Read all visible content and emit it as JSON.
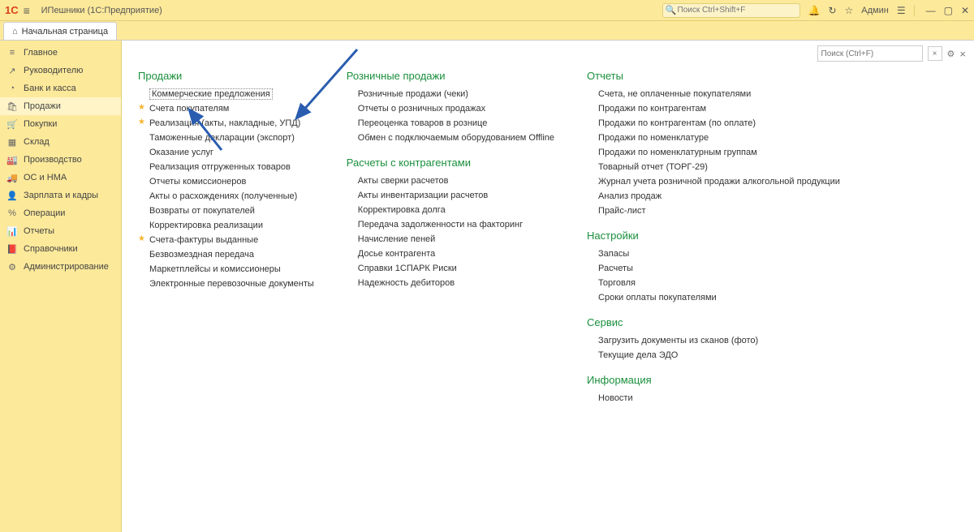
{
  "titlebar": {
    "app_title": "ИПешники  (1С:Предприятие)",
    "search_placeholder": "Поиск Ctrl+Shift+F",
    "user": "Админ"
  },
  "tabs": [
    {
      "label": "Начальная страница"
    }
  ],
  "sidebar": [
    {
      "icon": "≡",
      "label": "Главное",
      "name": "sidebar-main"
    },
    {
      "icon": "↗",
      "label": "Руководителю",
      "name": "sidebar-manager"
    },
    {
      "icon": "◔",
      "label": "Банк и касса",
      "name": "sidebar-bank"
    },
    {
      "icon": "🛍",
      "label": "Продажи",
      "name": "sidebar-sales",
      "active": true
    },
    {
      "icon": "🛒",
      "label": "Покупки",
      "name": "sidebar-purchases"
    },
    {
      "icon": "▦",
      "label": "Склад",
      "name": "sidebar-warehouse"
    },
    {
      "icon": "🏭",
      "label": "Производство",
      "name": "sidebar-production"
    },
    {
      "icon": "🚚",
      "label": "ОС и НМА",
      "name": "sidebar-assets"
    },
    {
      "icon": "👤",
      "label": "Зарплата и кадры",
      "name": "sidebar-payroll"
    },
    {
      "icon": "%",
      "label": "Операции",
      "name": "sidebar-operations"
    },
    {
      "icon": "📊",
      "label": "Отчеты",
      "name": "sidebar-reports"
    },
    {
      "icon": "📕",
      "label": "Справочники",
      "name": "sidebar-catalogs"
    },
    {
      "icon": "⚙",
      "label": "Администрирование",
      "name": "sidebar-admin"
    }
  ],
  "content_search_placeholder": "Поиск (Ctrl+F)",
  "columns": [
    {
      "sections": [
        {
          "title": "Продажи",
          "links": [
            {
              "label": "Коммерческие предложения",
              "boxed": true
            },
            {
              "label": "Счета покупателям",
              "starred": true
            },
            {
              "label": "Реализация (акты, накладные, УПД)",
              "starred": true
            },
            {
              "label": "Таможенные декларации (экспорт)"
            },
            {
              "label": "Оказание услуг"
            },
            {
              "label": "Реализация отгруженных товаров"
            },
            {
              "label": "Отчеты комиссионеров"
            },
            {
              "label": "Акты о расхождениях (полученные)"
            },
            {
              "label": "Возвраты от покупателей"
            },
            {
              "label": "Корректировка реализации"
            },
            {
              "label": "Счета-фактуры выданные",
              "starred": true
            },
            {
              "label": "Безвозмездная передача"
            },
            {
              "label": "Маркетплейсы и комиссионеры"
            },
            {
              "label": "Электронные перевозочные документы"
            }
          ]
        }
      ]
    },
    {
      "sections": [
        {
          "title": "Розничные продажи",
          "links": [
            {
              "label": "Розничные продажи (чеки)"
            },
            {
              "label": "Отчеты о розничных продажах"
            },
            {
              "label": "Переоценка товаров в рознице"
            },
            {
              "label": "Обмен с подключаемым оборудованием Offline"
            }
          ]
        },
        {
          "title": "Расчеты с контрагентами",
          "links": [
            {
              "label": "Акты сверки расчетов"
            },
            {
              "label": "Акты инвентаризации расчетов"
            },
            {
              "label": "Корректировка долга"
            },
            {
              "label": "Передача задолженности на факторинг"
            },
            {
              "label": "Начисление пеней"
            },
            {
              "label": "Досье контрагента"
            },
            {
              "label": "Справки 1СПАРК Риски"
            },
            {
              "label": "Надежность дебиторов"
            }
          ]
        }
      ]
    },
    {
      "sections": [
        {
          "title": "Отчеты",
          "links": [
            {
              "label": "Счета, не оплаченные покупателями"
            },
            {
              "label": "Продажи по контрагентам"
            },
            {
              "label": "Продажи по контрагентам (по оплате)"
            },
            {
              "label": "Продажи по номенклатуре"
            },
            {
              "label": "Продажи по номенклатурным группам"
            },
            {
              "label": "Товарный отчет (ТОРГ-29)"
            },
            {
              "label": "Журнал учета розничной продажи алкогольной продукции"
            },
            {
              "label": "Анализ продаж"
            },
            {
              "label": "Прайс-лист"
            }
          ]
        },
        {
          "title": "Настройки",
          "links": [
            {
              "label": "Запасы"
            },
            {
              "label": "Расчеты"
            },
            {
              "label": "Торговля"
            },
            {
              "label": "Сроки оплаты покупателями"
            }
          ]
        },
        {
          "title": "Сервис",
          "links": [
            {
              "label": "Загрузить документы из сканов (фото)"
            },
            {
              "label": "Текущие дела ЭДО"
            }
          ]
        },
        {
          "title": "Информация",
          "links": [
            {
              "label": "Новости"
            }
          ]
        }
      ]
    }
  ]
}
